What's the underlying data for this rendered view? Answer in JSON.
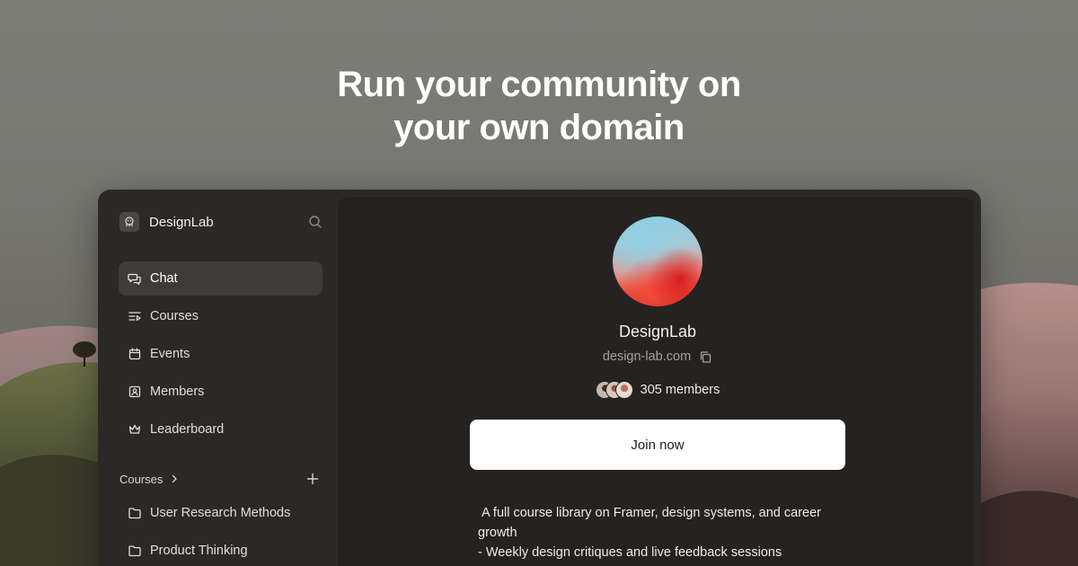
{
  "hero": {
    "line1": "Run your community on",
    "line2": "your own domain"
  },
  "sidebar": {
    "brand_name": "DesignLab",
    "nav": [
      {
        "label": "Chat",
        "icon": "chat-icon",
        "active": true
      },
      {
        "label": "Courses",
        "icon": "courses-list-icon",
        "active": false
      },
      {
        "label": "Events",
        "icon": "calendar-icon",
        "active": false
      },
      {
        "label": "Members",
        "icon": "member-card-icon",
        "active": false
      },
      {
        "label": "Leaderboard",
        "icon": "crown-icon",
        "active": false
      }
    ],
    "courses_header": "Courses",
    "courses": [
      {
        "label": "User Research Methods",
        "icon": "folder-icon"
      },
      {
        "label": "Product Thinking",
        "icon": "folder-icon"
      }
    ]
  },
  "main": {
    "community_name": "DesignLab",
    "domain": "design-lab.com",
    "members_label": "305 members",
    "join_label": "Join now",
    "description": [
      " A full course library on Framer, design systems, and career growth",
      "- Weekly design critiques and live feedback sessions"
    ]
  },
  "colors": {
    "window_bg": "#2a2927",
    "panel_bg": "#252321",
    "active_nav_bg": "#3e3c39",
    "join_button_bg": "#ffffff"
  }
}
